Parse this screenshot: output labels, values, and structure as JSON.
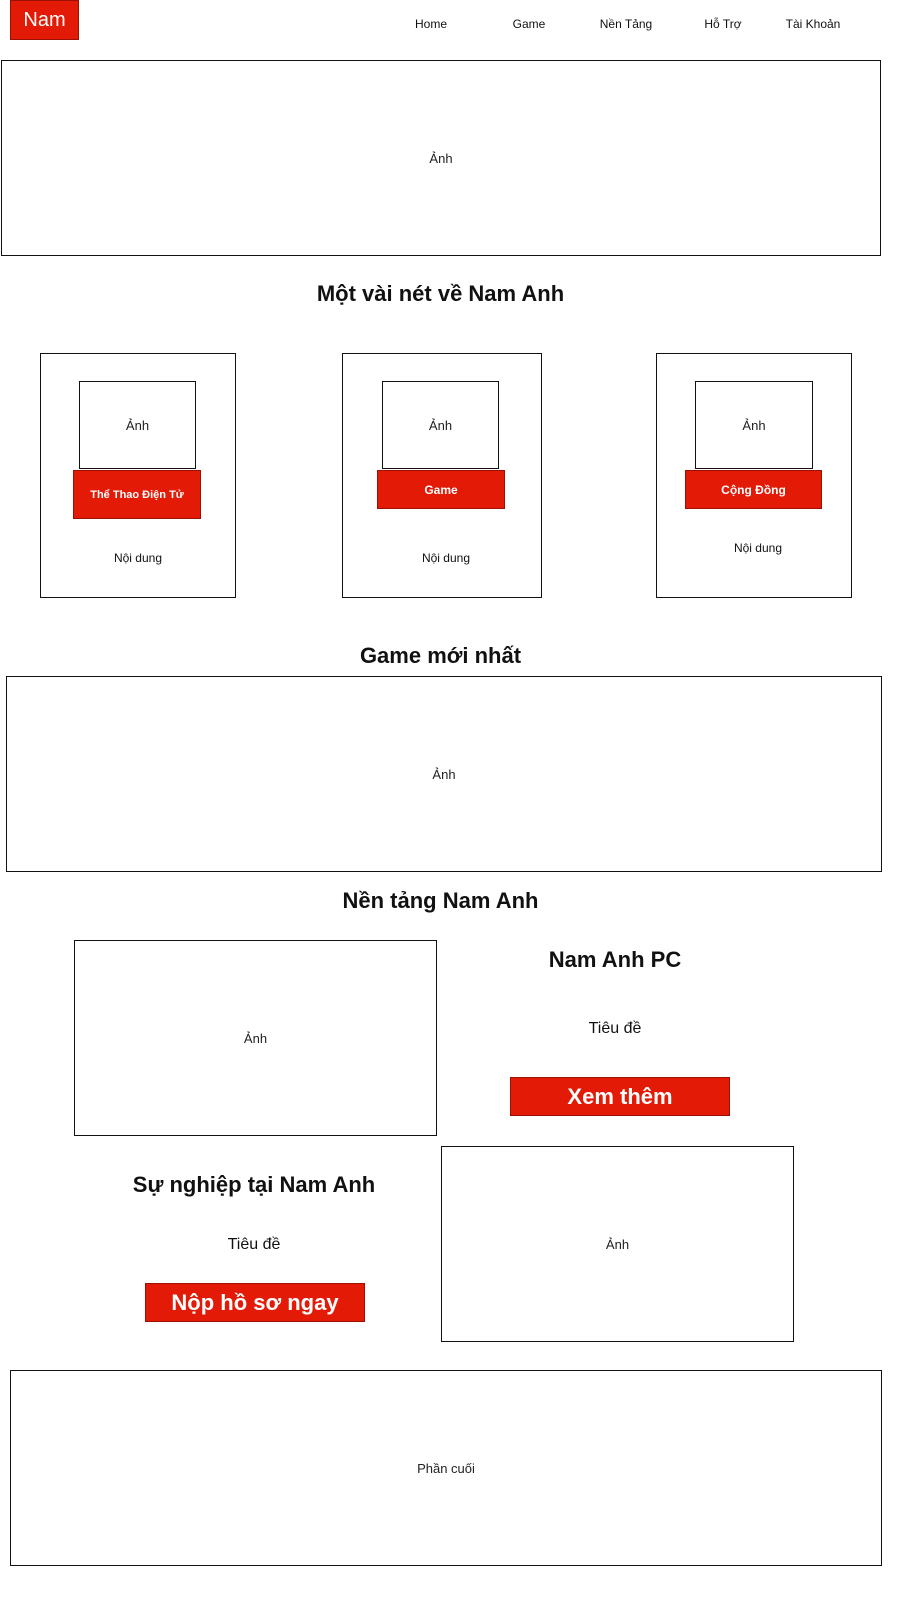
{
  "header": {
    "logo": "Nam",
    "nav": [
      "Home",
      "Game",
      "Nền Tảng",
      "Hỗ Trợ",
      "Tài Khoản"
    ]
  },
  "hero": {
    "placeholder": "Ảnh"
  },
  "about": {
    "title": "Một vài nét về Nam Anh",
    "cards": [
      {
        "image": "Ảnh",
        "button": "Thể Thao Điện Tử",
        "content": "Nội dung"
      },
      {
        "image": "Ảnh",
        "button": "Game",
        "content": "Nội dung"
      },
      {
        "image": "Ảnh",
        "button": "Cộng Đồng",
        "content": "Nội dung"
      }
    ]
  },
  "latest_game": {
    "title": "Game mới nhất",
    "placeholder": "Ảnh"
  },
  "platform": {
    "title": "Nền tảng Nam Anh",
    "image": "Ảnh",
    "heading": "Nam Anh PC",
    "subtitle": "Tiêu đề",
    "button": "Xem thêm"
  },
  "career": {
    "heading": "Sự nghiệp tại Nam Anh",
    "subtitle": "Tiêu đề",
    "button": "Nộp hồ sơ ngay",
    "image": "Ảnh"
  },
  "footer": {
    "placeholder": "Phần cuối"
  },
  "colors": {
    "accent": "#e31a06",
    "border": "#111111",
    "background": "#ffffff"
  }
}
